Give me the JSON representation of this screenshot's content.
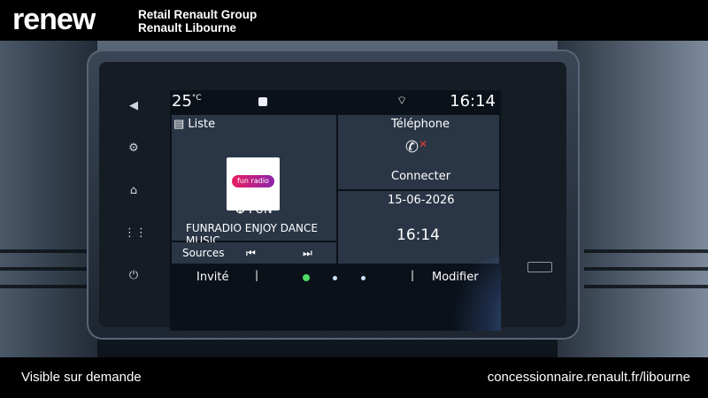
{
  "header": {
    "logo": "renew",
    "dealer_line1": "Retail Renault Group",
    "dealer_line2": "Renault Libourne"
  },
  "screen": {
    "temperature": "25",
    "temp_unit": "°C",
    "time": "16:14",
    "media": {
      "title": "Liste",
      "station_logo_text": "fun radio",
      "station_name": "FUN",
      "now_playing": "FUNRADIO ENJOY DANCE MUSIC",
      "sources_label": "Sources",
      "prev_icon": "previous-track-icon",
      "next_icon": "next-track-icon"
    },
    "phone": {
      "title": "Téléphone",
      "status": "Connecter"
    },
    "clock_widget": {
      "date": "15-06-2026",
      "time": "16:14"
    },
    "bottom": {
      "guest_label": "Invité",
      "edit_label": "Modifier",
      "page_count": 3,
      "active_page": 1
    }
  },
  "footer": {
    "left_text": "Visible sur demande",
    "right_text": "concessionnaire.renault.fr/libourne"
  },
  "colors": {
    "accent_green": "#4cd964",
    "phone_x": "#e53935",
    "panel_bg": "#2a3646"
  }
}
